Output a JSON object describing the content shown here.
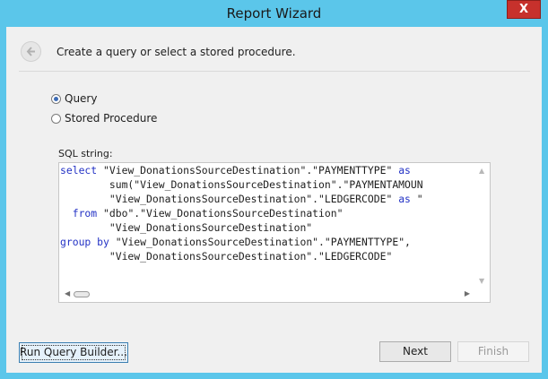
{
  "window": {
    "title": "Report Wizard",
    "close_glyph": "X"
  },
  "header": {
    "instruction": "Create a query or select a stored procedure.",
    "back_icon": "back-arrow-icon"
  },
  "options": [
    {
      "label": "Query",
      "selected": true
    },
    {
      "label": "Stored Procedure",
      "selected": false
    }
  ],
  "sql": {
    "label": "SQL string:",
    "lines": [
      {
        "kw1": "select",
        "text": " \"View_DonationsSourceDestination\".\"PAYMENTTYPE\" ",
        "kw2": "as"
      },
      {
        "kw1": "",
        "text": "        sum(\"View_DonationsSourceDestination\".\"PAYMENTAMOUN",
        "kw2": ""
      },
      {
        "kw1": "",
        "text": "        \"View_DonationsSourceDestination\".\"LEDGERCODE\" ",
        "kw2": "as",
        "tail": " \""
      },
      {
        "kw1": "  from",
        "text": " \"dbo\".\"View_DonationsSourceDestination\"",
        "kw2": ""
      },
      {
        "kw1": "",
        "text": "        \"View_DonationsSourceDestination\"",
        "kw2": ""
      },
      {
        "kw1": "group by",
        "text": " \"View_DonationsSourceDestination\".\"PAYMENTTYPE\",",
        "kw2": ""
      },
      {
        "kw1": "",
        "text": "        \"View_DonationsSourceDestination\".\"LEDGERCODE\"",
        "kw2": ""
      }
    ]
  },
  "buttons": {
    "query_builder": "Run Query Builder...",
    "next": "Next",
    "finish": "Finish"
  },
  "colors": {
    "titlebar": "#5bc6ea",
    "keyword": "#2332c5",
    "close": "#c7312c"
  }
}
